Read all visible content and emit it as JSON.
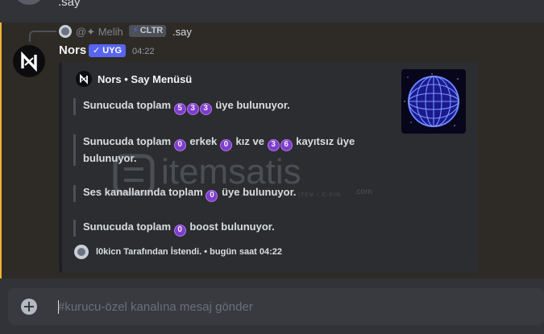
{
  "previous_message": {
    "text": ".say"
  },
  "message": {
    "reply": {
      "author": "@✦ Melih",
      "tag": "CLTR",
      "text": ".say"
    },
    "author": "Nors",
    "app_tag": "✓ UYG",
    "timestamp": "04:22",
    "embed": {
      "author": "Nors • Say Menüsü",
      "fields": [
        {
          "p1": "Sunucuda toplam",
          "n1": [
            "5",
            "3",
            "3"
          ],
          "p2": "üye bulunuyor."
        },
        {
          "p1": "Sunucuda toplam",
          "n1": [
            "0"
          ],
          "p2": "erkek",
          "n2": [
            "0"
          ],
          "p3": "kız ve",
          "n3": [
            "3",
            "6"
          ],
          "p4": "kayıtsız üye",
          "p5": "bulunuyor."
        },
        {
          "p1": "Ses kanallarında toplam",
          "n1": [
            "0"
          ],
          "p2": "üye bulunuyor."
        },
        {
          "p1": "Sunucuda toplam",
          "n1": [
            "0"
          ],
          "p2": "boost bulunuyor."
        }
      ],
      "footer": "l0kicn Tarafından İstendi. • bugün saat 04:22"
    }
  },
  "watermark": {
    "brand": "itemsatis",
    "tagline": "HESAP / OYUN / ITEM / E-PIN",
    "tld": ".com"
  },
  "composer": {
    "placeholder": "#kurucu-özel kanalına mesaj gönder"
  },
  "colors": {
    "accent": "#5865f2",
    "highlight_bar": "#f0b232",
    "number_emoji": "#7d3fc9"
  }
}
